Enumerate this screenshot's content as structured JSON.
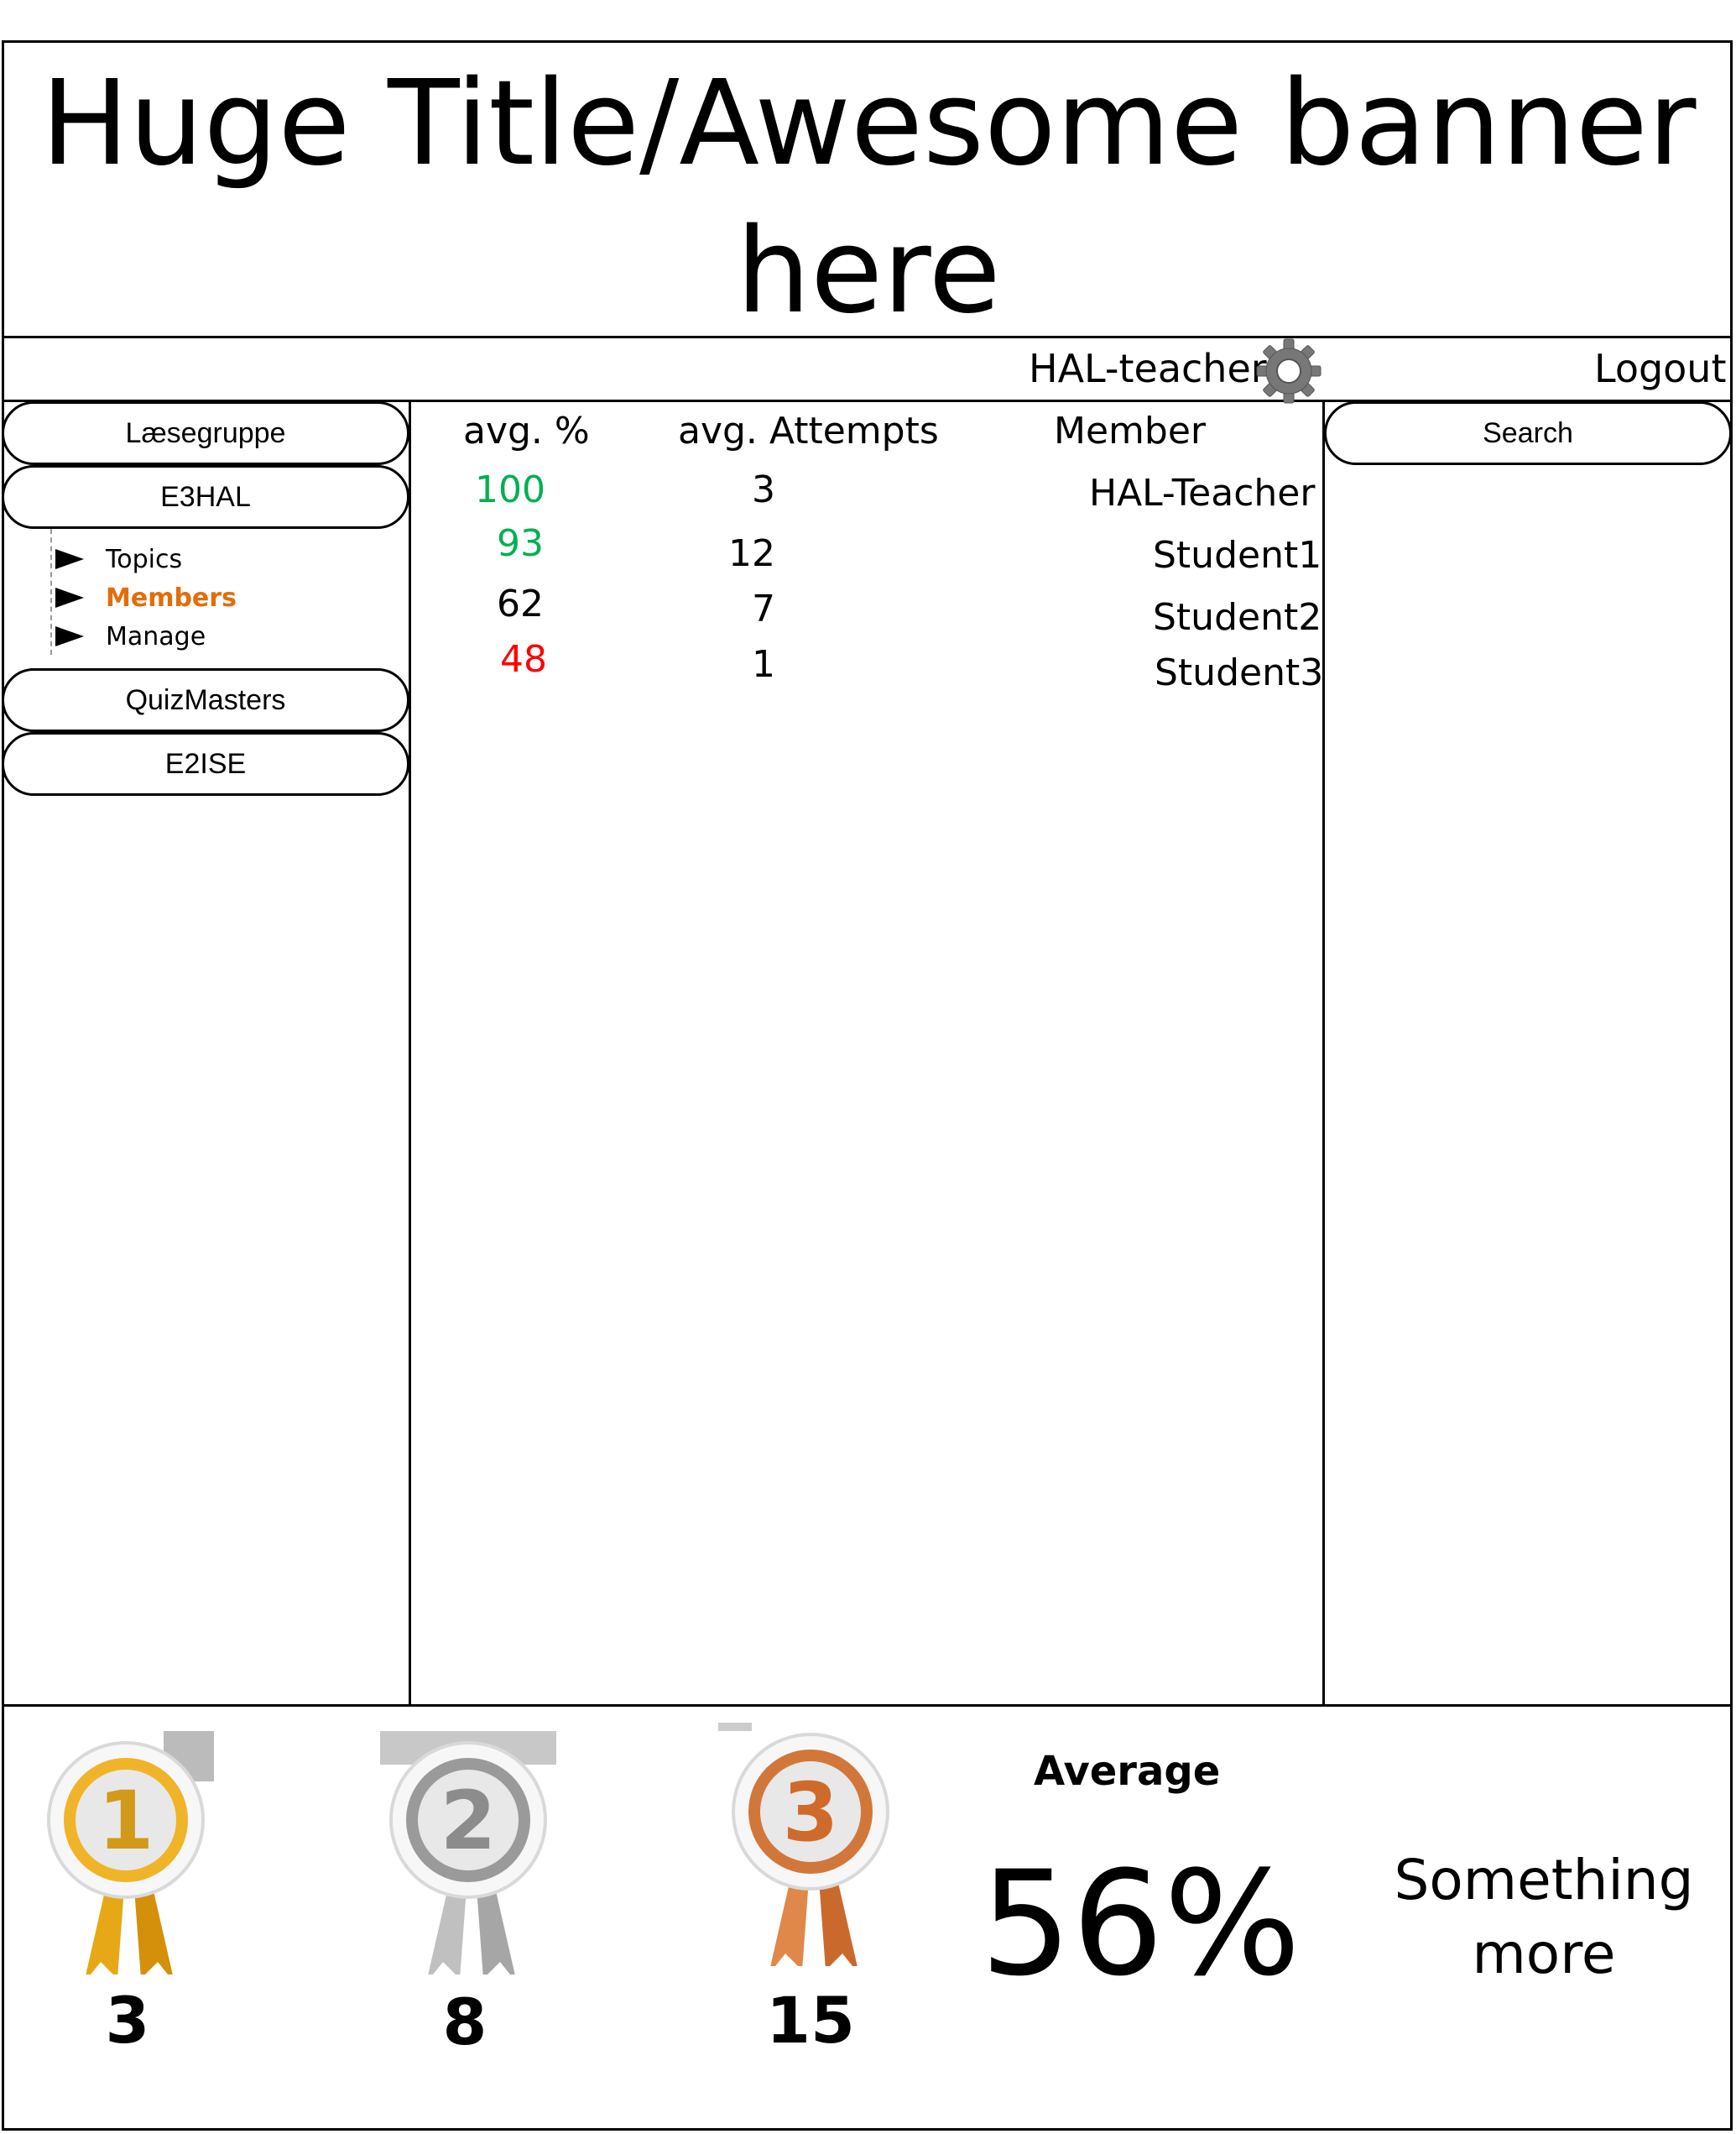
{
  "banner": {
    "title": "Huge Title/Awesome banner here"
  },
  "userbar": {
    "username": "HAL-teacher",
    "settings_icon": "gear-icon",
    "logout": "Logout"
  },
  "sidebar": {
    "groups": [
      {
        "label": "Læsegruppe"
      },
      {
        "label": "E3HAL"
      },
      {
        "label": "QuizMasters"
      },
      {
        "label": "E2ISE"
      }
    ],
    "subnav": [
      {
        "label": "Topics",
        "active": false
      },
      {
        "label": "Members",
        "active": true
      },
      {
        "label": "Manage",
        "active": false
      }
    ],
    "active_color": "#e46c0a"
  },
  "table": {
    "headers": {
      "avg_percent": "avg. %",
      "avg_attempts": "avg. Attempts",
      "member": "Member"
    },
    "rows": [
      {
        "avg_percent": "100",
        "avg_attempts": "3",
        "member": "HAL-Teacher",
        "color": "#00b050"
      },
      {
        "avg_percent": "93",
        "avg_attempts": "12",
        "member": "Student1",
        "color": "#00b050"
      },
      {
        "avg_percent": "62",
        "avg_attempts": "7",
        "member": "Student2",
        "color": "#000000"
      },
      {
        "avg_percent": "48",
        "avg_attempts": "1",
        "member": "Student3",
        "color": "#ff0000"
      }
    ]
  },
  "search": {
    "label": "Search"
  },
  "footer": {
    "medals": [
      {
        "icon": "gold-medal-1-icon",
        "rank": "1",
        "count": "3"
      },
      {
        "icon": "silver-medal-2-icon",
        "rank": "2",
        "count": "8"
      },
      {
        "icon": "bronze-medal-3-icon",
        "rank": "3",
        "count": "15"
      }
    ],
    "average_label": "Average",
    "average_value": "56%",
    "more": "Something more"
  }
}
